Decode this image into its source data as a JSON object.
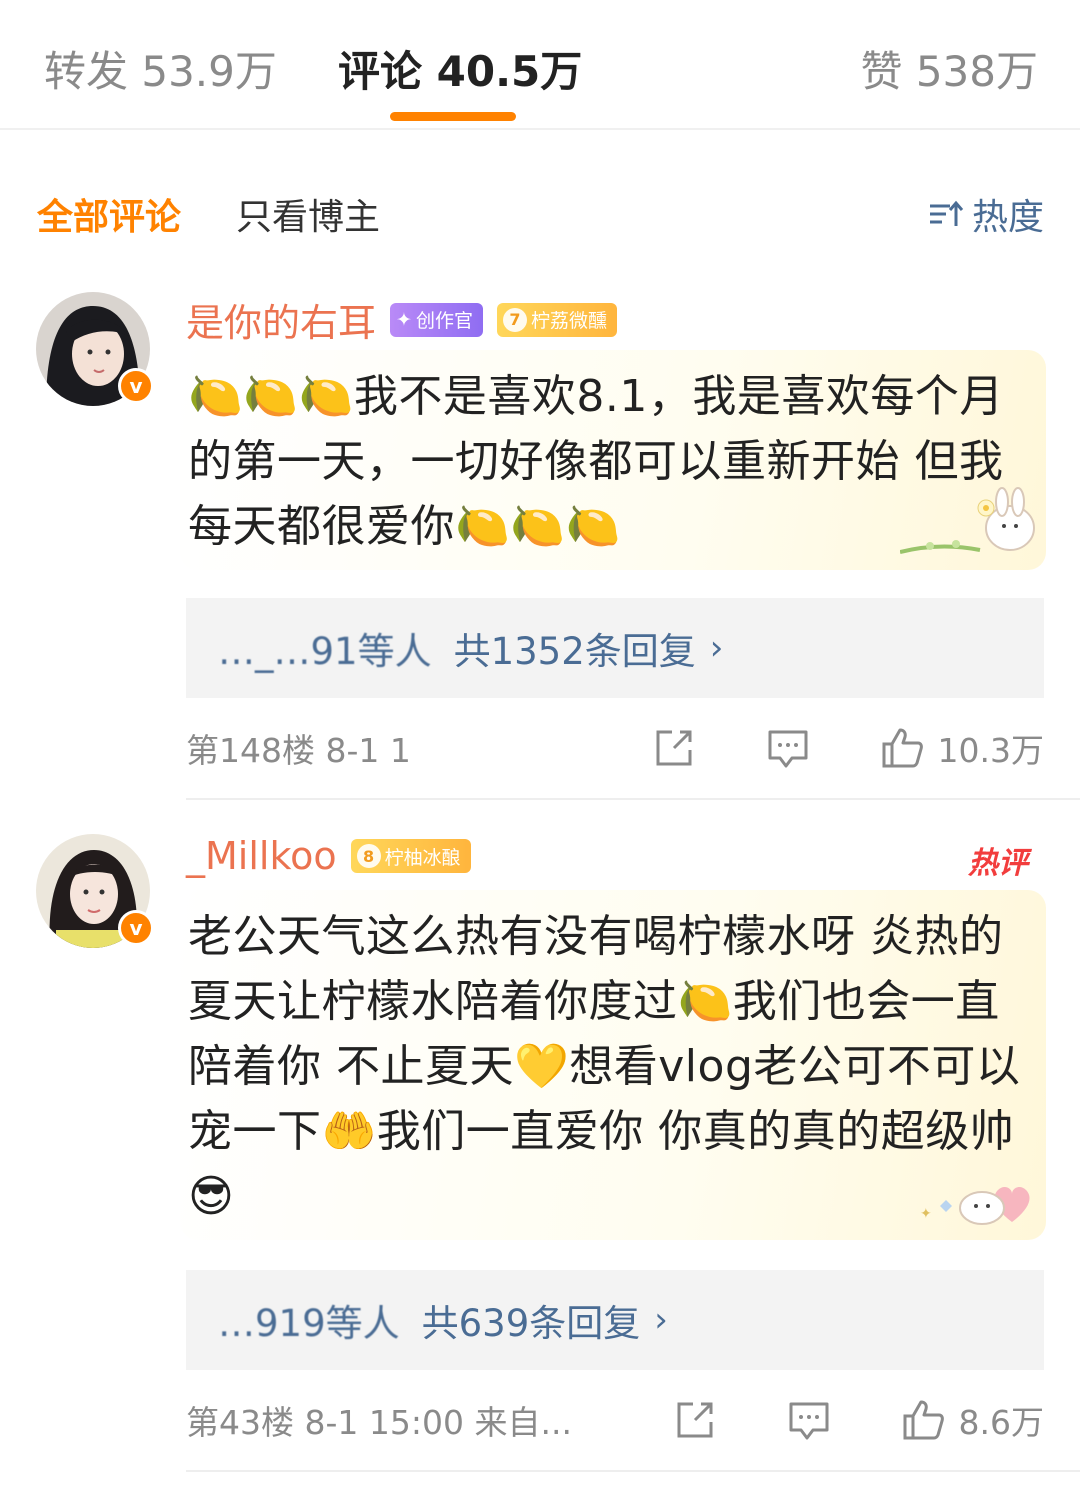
{
  "tabs": {
    "forward": "转发 53.9万",
    "comments": "评论 40.5万",
    "likes": "赞 538万"
  },
  "filter": {
    "all": "全部评论",
    "blogger_only": "只看博主",
    "sort": "热度"
  },
  "comments": [
    {
      "username": "是你的右耳",
      "badges": [
        "创作官",
        "柠荔微醺"
      ],
      "badge_level": "7",
      "text": "🍋🍋🍋我不是喜欢8.1，我是喜欢每个月的第一天，一切好像都可以重新开始 但我每天都很爱你🍋🍋🍋",
      "reply_names": "…_…91等人",
      "reply_total": "共1352条回复",
      "floor_time": "第148楼 8-1 1",
      "likes": "10.3万"
    },
    {
      "username": "_Millkoo",
      "badges": [
        "柠柚冰酿"
      ],
      "badge_level": "8",
      "hot": "热评",
      "text": "老公天气这么热有没有喝柠檬水呀 炎热的夏天让柠檬水陪着你度过🍋我们也会一直陪着你 不止夏天💛想看vlog老公可不可以宠一下🤲我们一直爱你 你真的真的超级帅😎",
      "reply_names": "…919等人",
      "reply_total": "共639条回复",
      "floor_time": "第43楼 8-1 15:00 来自...",
      "likes": "8.6万"
    }
  ],
  "colors": {
    "accent": "#ff8200",
    "username": "#eb7350",
    "link": "#4a6c94",
    "hot": "#f23d3d"
  },
  "icons": [
    "sort-icon",
    "verified-icon",
    "share-icon",
    "comment-icon",
    "like-icon",
    "chevron-right-icon"
  ]
}
